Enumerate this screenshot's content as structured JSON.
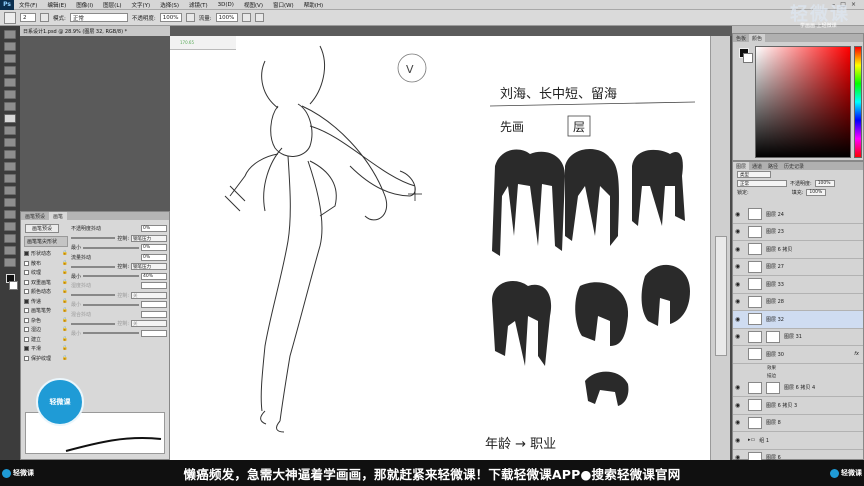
{
  "app": {
    "logo": "Ps",
    "menus": [
      "文件(F)",
      "编辑(E)",
      "图像(I)",
      "图层(L)",
      "文字(Y)",
      "选择(S)",
      "滤镜(T)",
      "3D(D)",
      "视图(V)",
      "窗口(W)",
      "帮助(H)"
    ],
    "window_controls": [
      "–",
      "□",
      "×"
    ]
  },
  "options": {
    "brush_size": "2",
    "mode_label": "模式:",
    "mode_value": "正常",
    "opacity_label": "不透明度:",
    "opacity_value": "100%",
    "flow_label": "流量:",
    "flow_value": "100%"
  },
  "document": {
    "tab_title": "日系设计1.psd @ 28.9% (图层 32, RGB/8) *"
  },
  "brush_panel": {
    "tabs": [
      "画笔预设",
      "画笔"
    ],
    "preset_button": "画笔预设",
    "section_header": "画笔笔尖形状",
    "items": [
      {
        "label": "形状动态",
        "checked": true
      },
      {
        "label": "散布",
        "checked": false
      },
      {
        "label": "纹理",
        "checked": false
      },
      {
        "label": "双重画笔",
        "checked": false
      },
      {
        "label": "颜色动态",
        "checked": false
      },
      {
        "label": "传递",
        "checked": true
      },
      {
        "label": "画笔笔势",
        "checked": false
      },
      {
        "label": "杂色",
        "checked": false
      },
      {
        "label": "湿边",
        "checked": false
      },
      {
        "label": "建立",
        "checked": false
      },
      {
        "label": "平滑",
        "checked": true
      },
      {
        "label": "保护纹理",
        "checked": false
      }
    ],
    "right_rows": [
      {
        "label": "不透明度抖动",
        "value": "0%"
      },
      {
        "label": "控制:",
        "select": "钢笔压力"
      },
      {
        "label": "最小",
        "value": "0%"
      },
      {
        "label": "流量抖动",
        "value": "0%"
      },
      {
        "label": "控制:",
        "select": "钢笔压力"
      },
      {
        "label": "最小",
        "value": "40%"
      },
      {
        "label": "湿度抖动",
        "value": ""
      },
      {
        "label": "控制:",
        "select": "关"
      },
      {
        "label": "最小",
        "value": ""
      },
      {
        "label": "混合抖动",
        "value": ""
      },
      {
        "label": "控制:",
        "select": "关"
      },
      {
        "label": "最小",
        "value": ""
      }
    ]
  },
  "color_panel": {
    "tabs": [
      "色板",
      "颜色"
    ],
    "foreground": "#111111",
    "background": "#ffffff"
  },
  "layers_panel": {
    "tabs": [
      "图层",
      "通道",
      "路径",
      "历史记录"
    ],
    "kind_label": "类型",
    "blend_mode": "正常",
    "opacity_label": "不透明度:",
    "opacity_value": "100%",
    "lock_label": "锁定:",
    "fill_label": "填充:",
    "fill_value": "100%",
    "layers": [
      {
        "name": "图层 24",
        "visible": true,
        "selected": false,
        "mask": false,
        "fx": false
      },
      {
        "name": "图层 23",
        "visible": true,
        "selected": false,
        "mask": false,
        "fx": false
      },
      {
        "name": "图层 6 拷贝",
        "visible": true,
        "selected": false,
        "mask": false,
        "fx": false
      },
      {
        "name": "图层 27",
        "visible": true,
        "selected": false,
        "mask": false,
        "fx": false
      },
      {
        "name": "图层 33",
        "visible": true,
        "selected": false,
        "mask": false,
        "fx": false
      },
      {
        "name": "图层 28",
        "visible": true,
        "selected": false,
        "mask": false,
        "fx": false
      },
      {
        "name": "图层 32",
        "visible": true,
        "selected": true,
        "mask": false,
        "fx": false
      },
      {
        "name": "图层 31",
        "visible": true,
        "selected": false,
        "mask": true,
        "fx": false
      },
      {
        "name": "图层 30",
        "visible": false,
        "selected": false,
        "mask": false,
        "fx": true
      },
      {
        "name": "图层 6 拷贝 4",
        "visible": true,
        "selected": false,
        "mask": true,
        "fx": false
      },
      {
        "name": "图层 6 拷贝 3",
        "visible": true,
        "selected": false,
        "mask": false,
        "fx": false
      },
      {
        "name": "图层 8",
        "visible": true,
        "selected": false,
        "mask": false,
        "fx": false
      },
      {
        "name": "组 1",
        "visible": true,
        "selected": false,
        "mask": false,
        "fx": false
      },
      {
        "name": "图层 6",
        "visible": true,
        "selected": false,
        "mask": false,
        "fx": false
      }
    ],
    "effects_label": "效果",
    "effect_item": "描边"
  },
  "canvas_notes": {
    "line1": "刘海、长中短、留海",
    "line2": "先画",
    "line2_box": "层",
    "bottom": "年龄 → 职业",
    "check": "V",
    "thumb_label": "170.65"
  },
  "watermark": {
    "brand": "轻微课",
    "brand_top": "轻微课",
    "brand_top_sub": "学画画 上轻微课"
  },
  "banner": {
    "logo_left": "轻微课",
    "text": "懒癌频发，急需大神逼着学画画，那就赶紧来轻微课！下载轻微课APP●搜索轻微课官网",
    "logo_right": "轻微课"
  }
}
